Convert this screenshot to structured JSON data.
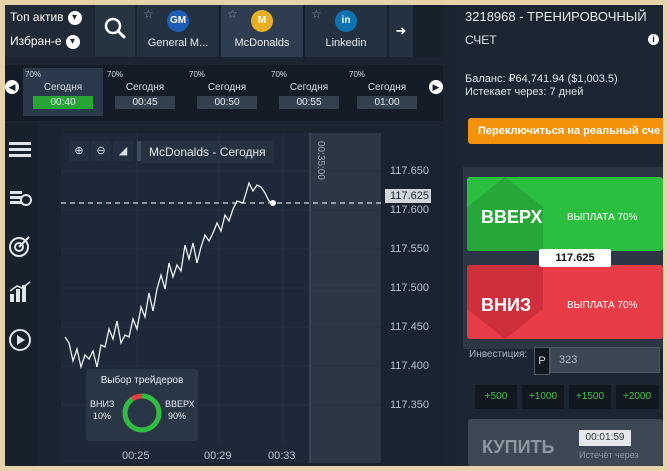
{
  "top_left": {
    "top_assets": "Топ актив",
    "favorites": "Избран-е"
  },
  "assets": [
    {
      "name": "General M...",
      "logo": "GM",
      "color": "#1d5db7"
    },
    {
      "name": "McDonalds",
      "logo": "M",
      "color": "#e8b020"
    },
    {
      "name": "Linkedin",
      "logo": "in",
      "color": "#0d72b1"
    }
  ],
  "expiry": [
    {
      "pct": "70%",
      "day": "Сегодня",
      "time": "00:40"
    },
    {
      "pct": "70%",
      "day": "Сегодня",
      "time": "00:45"
    },
    {
      "pct": "70%",
      "day": "Сегодня",
      "time": "00:50"
    },
    {
      "pct": "70%",
      "day": "Сегодня",
      "time": "00:55"
    },
    {
      "pct": "70%",
      "day": "Сегодня",
      "time": "01:00"
    }
  ],
  "chart": {
    "title": "McDonalds - Сегодня",
    "timeframe": "1h",
    "expiry_mark": "00:35:00",
    "current_price": "117.625",
    "y_ticks": [
      "117.650",
      "117.600",
      "117.550",
      "117.500",
      "117.450",
      "117.400",
      "117.350"
    ],
    "x_ticks": [
      "00:25",
      "00:29",
      "00:33"
    ],
    "trader_choice": {
      "title": "Выбор трейдеров",
      "down_label": "ВНИЗ",
      "down_pct": "10%",
      "up_label": "ВВЕРХ",
      "up_pct": "90%",
      "up_share": 0.9
    }
  },
  "account": {
    "id": "3218968 - ТРЕНИРОВОЧНЫЙ",
    "type": "СЧЕТ",
    "balance": "Баланс: ₽64,741.94 ($1,003.5)",
    "expires": "Истекает через: 7 дней",
    "switch_label": "Переключиться на реальный сче"
  },
  "trade": {
    "up_label": "ВВЕРХ",
    "up_payout": "ВЫПЛАТА 70%",
    "down_label": "ВНИЗ",
    "down_payout": "ВЫПЛАТА 70%",
    "price": "117.625",
    "invest_label": "Инвестиция:",
    "currency": "Р",
    "amount": "323",
    "quick": [
      "+500",
      "+1000",
      "+1500",
      "+2000"
    ],
    "buy_label": "КУПИТЬ",
    "buy_timer": "00:01:59",
    "buy_sub": "Истечёт через"
  },
  "colors": {
    "up": "#2bbf3f",
    "down": "#e83c47",
    "orange": "#f5920b",
    "active_time": "#27a534"
  }
}
